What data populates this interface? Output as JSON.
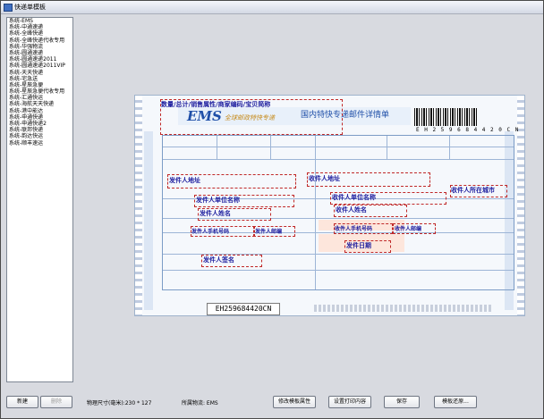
{
  "window": {
    "title": "快递单模板"
  },
  "sidebar": {
    "items": [
      "系统-EMS",
      "系统-中通速递",
      "系统-全峰快递",
      "系统-全峰快递代收专用",
      "系统-华强物流",
      "系统-圆通速递",
      "系统-圆通速递2011",
      "系统-圆通速递2011VIP",
      "系统-天天快递",
      "系统-宅急送",
      "系统-星辰急便",
      "系统-星辰急便代收专用",
      "系统-汇通快运",
      "系统-海航天天快递",
      "系统-港中能达",
      "系统-申通快递",
      "系统-申通快递2",
      "系统-联邦快递",
      "系统-韵达快运",
      "系统-顺丰速运"
    ]
  },
  "form": {
    "ems_logo": "EMS",
    "ems_sub": "全球邮政特快专递",
    "heading": "国内特快专递邮件详情单",
    "barcode_text": "E H 2 5 9 6 8 4 4 2 0 C N",
    "tracking_number": "EH259684420CN",
    "fields": {
      "quantity": "数量/总计/销售属性/商家编码/宝贝简称",
      "sender_address": "发件人地址",
      "sender_company": "发件人单位名称",
      "sender_name": "发件人姓名",
      "sender_phone": "发件人手机号码",
      "sender_zip": "发件人邮编",
      "sender_signature": "发件人签名",
      "recipient_address": "收件人地址",
      "recipient_company": "收件人单位名称",
      "recipient_name": "收件人姓名",
      "recipient_phone": "收件人手机号码",
      "recipient_zip": "收件人邮编",
      "recipient_city": "收件人所在城市",
      "send_date": "发件日期"
    }
  },
  "footer": {
    "new_label": "新建",
    "delete_label": "删除",
    "physical_size": "物理尺寸(毫米):230 * 127",
    "logistics": "所属物流: EMS",
    "modify_label": "修改模板属性",
    "print_content_label": "设置打印内容",
    "save_label": "保存",
    "restore_label": "模板还原..."
  }
}
